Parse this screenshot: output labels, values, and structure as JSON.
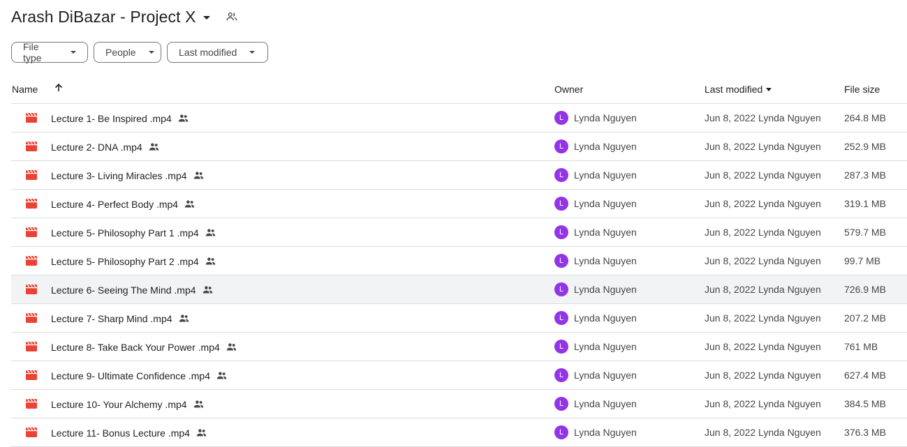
{
  "header": {
    "title": "Arash DiBazar - Project X",
    "share_icon": "people-icon"
  },
  "filters": [
    {
      "label": "File type"
    },
    {
      "label": "People"
    },
    {
      "label": "Last modified"
    }
  ],
  "columns": {
    "name": "Name",
    "owner": "Owner",
    "modified": "Last modified",
    "size": "File size"
  },
  "colors": {
    "file_icon": "#ea4335",
    "avatar": "#9334e6",
    "selected_row": "#f1f3f4"
  },
  "rows": [
    {
      "name": "Lecture 1- Be Inspired .mp4",
      "owner": "Lynda Nguyen",
      "avatar": "L",
      "modified": "Jun 8, 2022 Lynda Nguyen",
      "size": "264.8 MB"
    },
    {
      "name": "Lecture 2- DNA .mp4",
      "owner": "Lynda Nguyen",
      "avatar": "L",
      "modified": "Jun 8, 2022 Lynda Nguyen",
      "size": "252.9 MB"
    },
    {
      "name": "Lecture 3- Living Miracles .mp4",
      "owner": "Lynda Nguyen",
      "avatar": "L",
      "modified": "Jun 8, 2022 Lynda Nguyen",
      "size": "287.3 MB"
    },
    {
      "name": "Lecture 4- Perfect Body .mp4",
      "owner": "Lynda Nguyen",
      "avatar": "L",
      "modified": "Jun 8, 2022 Lynda Nguyen",
      "size": "319.1 MB"
    },
    {
      "name": "Lecture 5- Philosophy Part 1 .mp4",
      "owner": "Lynda Nguyen",
      "avatar": "L",
      "modified": "Jun 8, 2022 Lynda Nguyen",
      "size": "579.7 MB"
    },
    {
      "name": "Lecture 5- Philosophy Part 2 .mp4",
      "owner": "Lynda Nguyen",
      "avatar": "L",
      "modified": "Jun 8, 2022 Lynda Nguyen",
      "size": "99.7 MB"
    },
    {
      "name": "Lecture 6- Seeing The Mind .mp4",
      "owner": "Lynda Nguyen",
      "avatar": "L",
      "modified": "Jun 8, 2022 Lynda Nguyen",
      "size": "726.9 MB"
    },
    {
      "name": "Lecture 7- Sharp Mind .mp4",
      "owner": "Lynda Nguyen",
      "avatar": "L",
      "modified": "Jun 8, 2022 Lynda Nguyen",
      "size": "207.2 MB"
    },
    {
      "name": "Lecture 8- Take Back Your Power .mp4",
      "owner": "Lynda Nguyen",
      "avatar": "L",
      "modified": "Jun 8, 2022 Lynda Nguyen",
      "size": "761 MB"
    },
    {
      "name": "Lecture 9- Ultimate Confidence .mp4",
      "owner": "Lynda Nguyen",
      "avatar": "L",
      "modified": "Jun 8, 2022 Lynda Nguyen",
      "size": "627.4 MB"
    },
    {
      "name": "Lecture 10- Your Alchemy .mp4",
      "owner": "Lynda Nguyen",
      "avatar": "L",
      "modified": "Jun 8, 2022 Lynda Nguyen",
      "size": "384.5 MB"
    },
    {
      "name": "Lecture 11- Bonus Lecture .mp4",
      "owner": "Lynda Nguyen",
      "avatar": "L",
      "modified": "Jun 8, 2022 Lynda Nguyen",
      "size": "376.3 MB"
    }
  ]
}
